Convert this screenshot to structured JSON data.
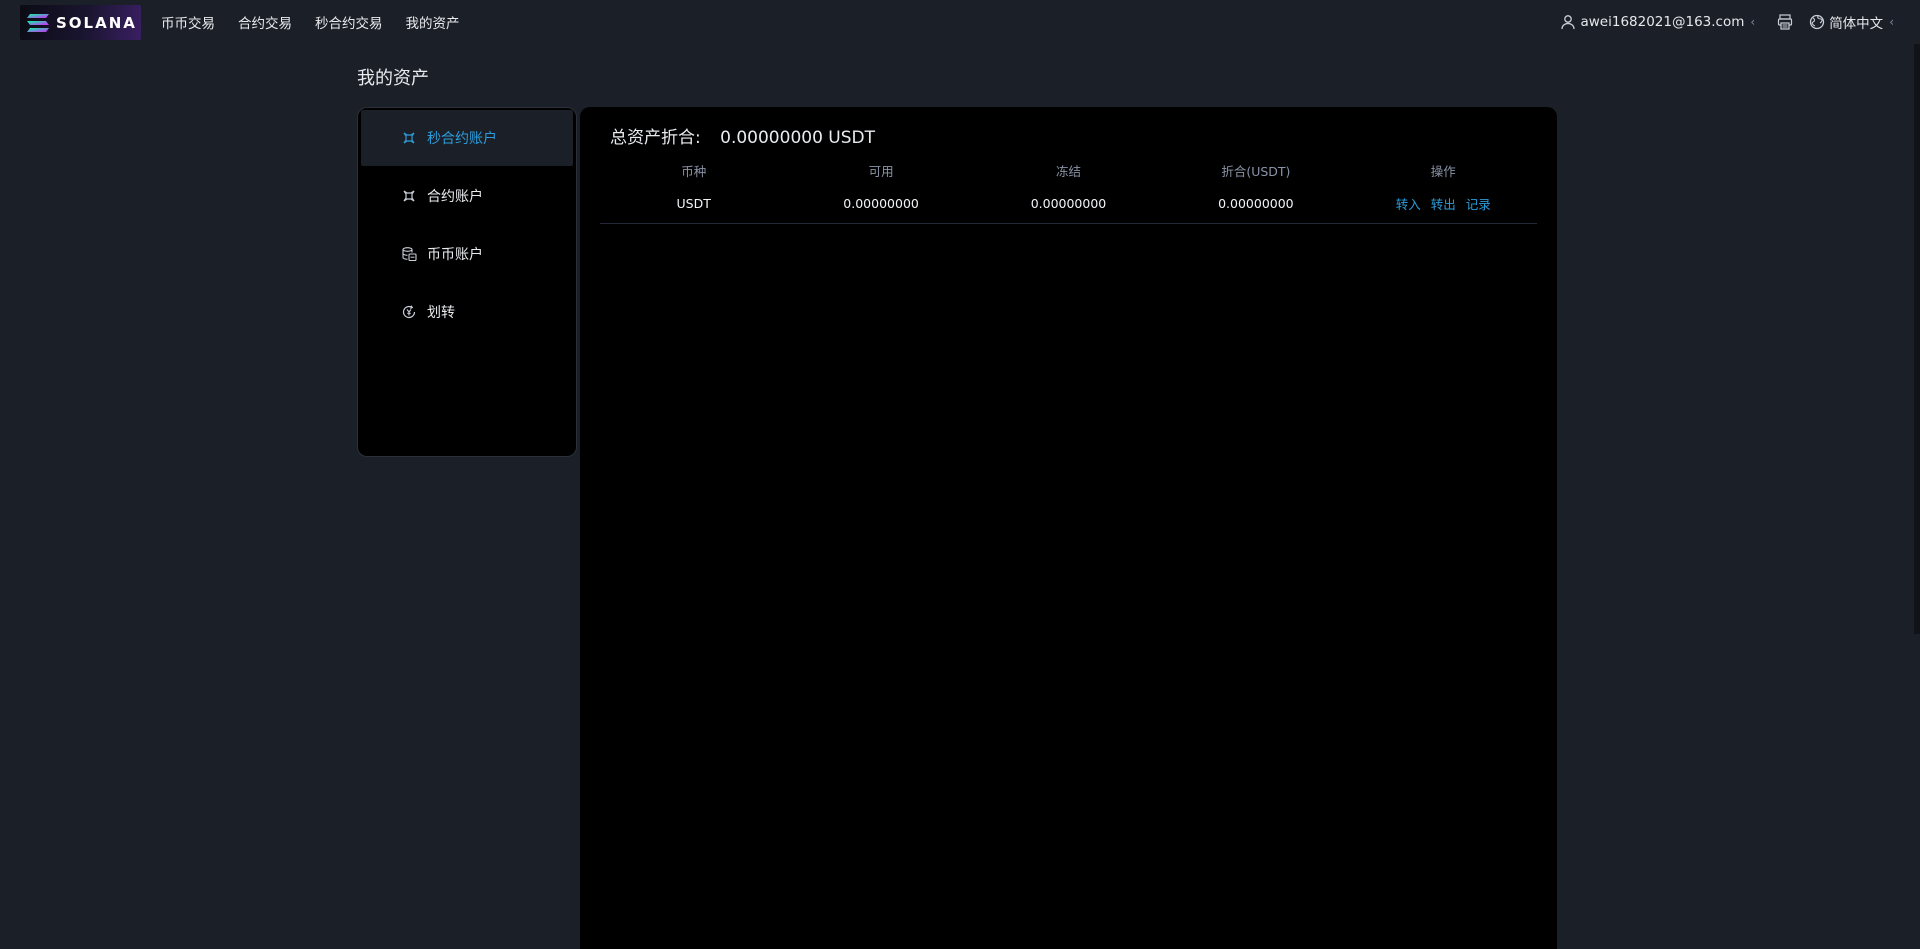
{
  "brand": {
    "name": "SOLANA"
  },
  "nav": {
    "items": [
      "币币交易",
      "合约交易",
      "秒合约交易",
      "我的资产"
    ]
  },
  "header": {
    "user_email": "awei1682021@163.com",
    "caret": "‹",
    "language": "简体中文"
  },
  "page": {
    "title": "我的资产"
  },
  "sidebar": {
    "items": [
      {
        "label": "秒合约账户",
        "icon": "contract-icon",
        "active": true
      },
      {
        "label": "合约账户",
        "icon": "contract-icon",
        "active": false
      },
      {
        "label": "币币账户",
        "icon": "wallet-icon",
        "active": false
      },
      {
        "label": "划转",
        "icon": "transfer-icon",
        "active": false
      }
    ]
  },
  "summary": {
    "label": "总资产折合:",
    "value": "0.00000000 USDT"
  },
  "table": {
    "headers": [
      "币种",
      "可用",
      "冻结",
      "折合(USDT)",
      "操作"
    ],
    "rows": [
      {
        "coin": "USDT",
        "available": "0.00000000",
        "frozen": "0.00000000",
        "equiv": "0.00000000"
      }
    ],
    "actions": [
      "转入",
      "转出",
      "记录"
    ]
  },
  "colors": {
    "background": "#1b1f27",
    "panel": "#000000",
    "accent": "#2d9cdb"
  }
}
